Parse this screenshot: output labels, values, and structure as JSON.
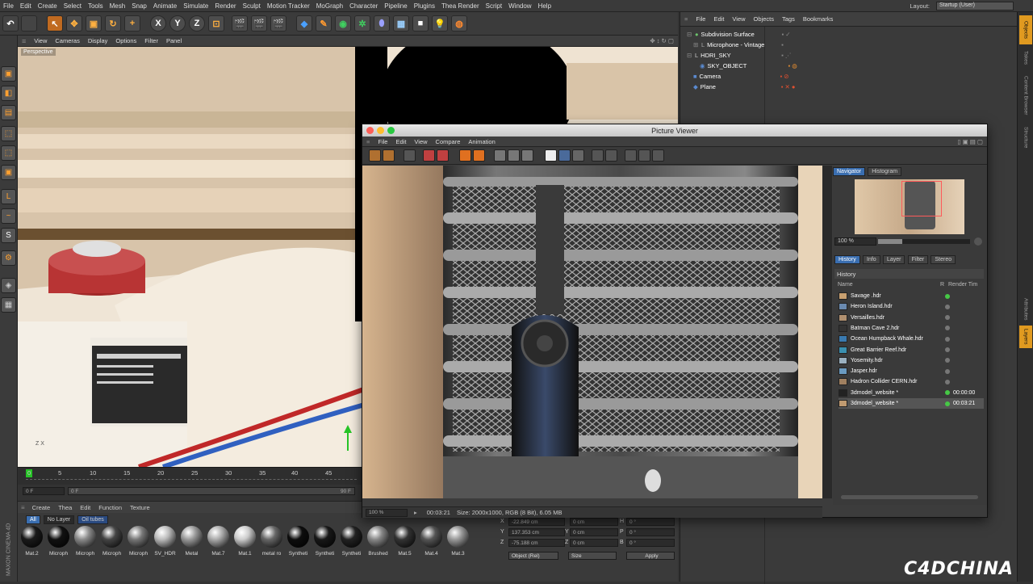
{
  "menubar": {
    "items": [
      "File",
      "Edit",
      "Create",
      "Select",
      "Tools",
      "Mesh",
      "Snap",
      "Animate",
      "Simulate",
      "Render",
      "Sculpt",
      "Motion Tracker",
      "MoGraph",
      "Character",
      "Pipeline",
      "Plugins",
      "Thea Render",
      "Script",
      "Window",
      "Help"
    ],
    "layout_label": "Layout:",
    "layout_value": "Startup (User)"
  },
  "toolbar": {
    "axis_x": "X",
    "axis_y": "Y",
    "axis_z": "Z"
  },
  "viewport": {
    "menu": [
      "View",
      "Cameras",
      "Display",
      "Options",
      "Filter",
      "Panel"
    ],
    "label": "Perspective",
    "axis_label": "Z X"
  },
  "timeline": {
    "ticks": [
      "0",
      "5",
      "10",
      "15",
      "20",
      "25",
      "30",
      "35",
      "40",
      "45"
    ],
    "start_frame": "0 F",
    "field2": "0 F",
    "end_frame": "90 F"
  },
  "materials": {
    "menu": [
      "Create",
      "Thea",
      "Edit",
      "Function",
      "Texture"
    ],
    "filters": [
      "All",
      "No Layer",
      "Oil tubes"
    ],
    "items": [
      {
        "name": "Mat.2",
        "color": "#1a1a1a"
      },
      {
        "name": "Microph",
        "color": "#111"
      },
      {
        "name": "Microph",
        "color": "#8a8a8a"
      },
      {
        "name": "Microph",
        "color": "#444"
      },
      {
        "name": "Microph",
        "color": "#777"
      },
      {
        "name": "SV_HDR",
        "color": "#bbb"
      },
      {
        "name": "Metal",
        "color": "#999"
      },
      {
        "name": "Mat.7",
        "color": "#aaa"
      },
      {
        "name": "Mat.1",
        "color": "#ccc"
      },
      {
        "name": "metal ro",
        "color": "#666"
      },
      {
        "name": "Syntheti",
        "color": "#0d0d0d"
      },
      {
        "name": "Syntheti",
        "color": "#181818"
      },
      {
        "name": "Syntheti",
        "color": "#222"
      },
      {
        "name": "Brushed",
        "color": "#888"
      },
      {
        "name": "Mat.5",
        "color": "#333"
      },
      {
        "name": "Mat.4",
        "color": "#555"
      },
      {
        "name": "Mat.3",
        "color": "#999"
      }
    ]
  },
  "attributes": {
    "rows": [
      {
        "axis": "X",
        "pos": "-22.849 cm",
        "size_axis": "",
        "size": "0 cm",
        "rot_axis": "H",
        "rot": "0 °"
      },
      {
        "axis": "Y",
        "pos": "137.353 cm",
        "size_axis": "Y",
        "size": "0 cm",
        "rot_axis": "P",
        "rot": "0 °"
      },
      {
        "axis": "Z",
        "pos": "-75.188 cm",
        "size_axis": "Z",
        "size": "0 cm",
        "rot_axis": "B",
        "rot": "0 °"
      }
    ],
    "coord_mode": "Object (Rel)",
    "size_mode": "Size",
    "apply": "Apply"
  },
  "objects": {
    "menu": [
      "File",
      "Edit",
      "View",
      "Objects",
      "Tags",
      "Bookmarks"
    ],
    "items": [
      {
        "name": "Subdivision Surface",
        "icon_color": "#6cc36c"
      },
      {
        "name": "Microphone - Vintage",
        "icon_color": "#9a9a9a"
      },
      {
        "name": "HDRI_SKY",
        "icon_color": "#ccc"
      },
      {
        "name": "SKY_OBJECT",
        "icon_color": "#5a8ad0"
      },
      {
        "name": "Camera",
        "icon_color": "#5a8ad0"
      },
      {
        "name": "Plane",
        "icon_color": "#5a8ad0"
      }
    ]
  },
  "right_tabs": [
    "Objects",
    "Takes",
    "Content Browser",
    "Structure",
    "Attributes",
    "Layers"
  ],
  "picture_viewer": {
    "title": "Picture Viewer",
    "menu": [
      "File",
      "Edit",
      "View",
      "Compare",
      "Animation"
    ],
    "side_tabs_top": [
      "Navigator",
      "Histogram"
    ],
    "zoom": "100 %",
    "side_tabs": [
      "History",
      "Info",
      "Layer",
      "Filter",
      "Stereo"
    ],
    "history_header": "History",
    "columns": {
      "name": "Name",
      "r": "R",
      "time": "Render Tim"
    },
    "history": [
      {
        "name": "Savage .hdr",
        "time": "",
        "dot": "#46c846",
        "thumb": "#c8a070"
      },
      {
        "name": "Heron Island.hdr",
        "time": "",
        "dot": "#777",
        "thumb": "#6a8ab0"
      },
      {
        "name": "Versailles.hdr",
        "time": "",
        "dot": "#777",
        "thumb": "#b09070"
      },
      {
        "name": "Batman Cave 2.hdr",
        "time": "",
        "dot": "#777",
        "thumb": "#333"
      },
      {
        "name": "Ocean Humpback Whale.hdr",
        "time": "",
        "dot": "#777",
        "thumb": "#3a7ab0"
      },
      {
        "name": "Great Barrier Reef.hdr",
        "time": "",
        "dot": "#777",
        "thumb": "#3a90b0"
      },
      {
        "name": "Yosemity.hdr",
        "time": "",
        "dot": "#777",
        "thumb": "#9ab0c0"
      },
      {
        "name": "Jasper.hdr",
        "time": "",
        "dot": "#777",
        "thumb": "#6a9ac0"
      },
      {
        "name": "Hadron Collider CERN.hdr",
        "time": "",
        "dot": "#777",
        "thumb": "#a08060"
      },
      {
        "name": "3dmodel_website *",
        "time": "00:00:00",
        "dot": "#46c846",
        "thumb": "#222"
      },
      {
        "name": "3dmodel_website *",
        "time": "00:03:21",
        "dot": "#46c846",
        "thumb": "#c09a70"
      }
    ],
    "status_zoom": "100 %",
    "status_time": "00:03:21",
    "status_info": "Size: 2000x1000, RGB (8 Bit), 6.05 MB"
  },
  "branding": {
    "maxon": "MAXON CINEMA 4D",
    "watermark": "C4DCHINA"
  }
}
